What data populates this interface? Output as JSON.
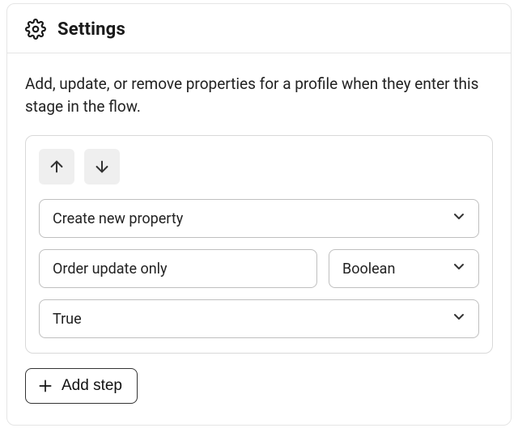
{
  "header": {
    "title": "Settings"
  },
  "description": "Add, update, or remove properties for a profile when they enter this stage in the flow.",
  "step": {
    "action_select": "Create new property",
    "property_name": "Order update only",
    "type_select": "Boolean",
    "value_select": "True"
  },
  "add_step_label": "Add step"
}
